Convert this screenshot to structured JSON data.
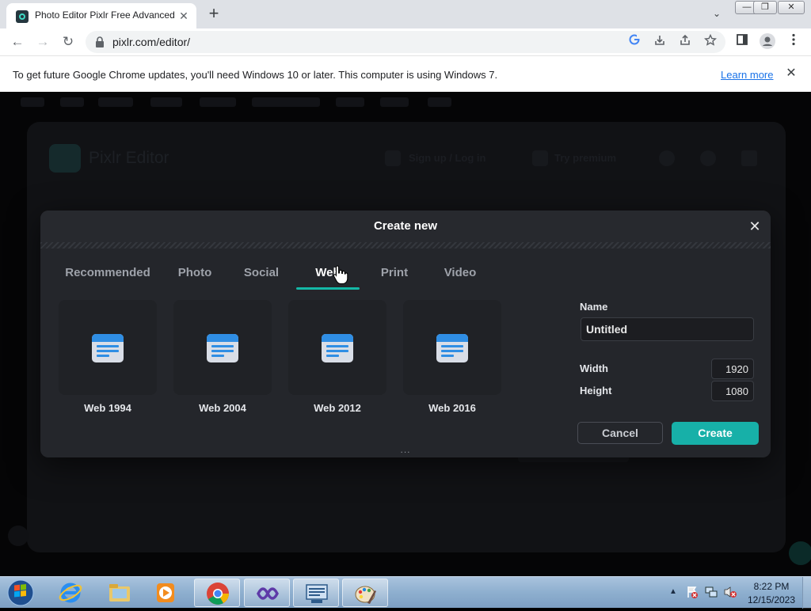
{
  "browser": {
    "tab_title": "Photo Editor Pixlr Free Advanced Photo Editor",
    "tab_close": "✕",
    "new_tab": "+",
    "tab_search": "⌄",
    "win_min": "—",
    "win_restore": "❐",
    "win_close": "✕",
    "back": "←",
    "forward": "→",
    "reload": "↻",
    "url": "pixlr.com/editor/",
    "lock": "🔒",
    "icons": [
      "google-icon",
      "download-icon",
      "share-icon",
      "star-icon",
      "sidebar-icon",
      "profile-icon",
      "kebab-menu-icon"
    ]
  },
  "infobar": {
    "message": "To get future Google Chrome updates, you'll need Windows 10 or later. This computer is using Windows 7.",
    "learn_more": "Learn more",
    "close": "✕"
  },
  "pixlr": {
    "brand": "Pixlr Editor",
    "signup": "Sign up / Log in",
    "premium": "Try premium"
  },
  "dialog": {
    "title": "Create new",
    "close": "✕",
    "tabs": [
      "Recommended",
      "Photo",
      "Social",
      "Web",
      "Print",
      "Video"
    ],
    "active_tab": "Web",
    "templates": [
      "Web 1994",
      "Web 2004",
      "Web 2012",
      "Web 2016"
    ],
    "name_label": "Name",
    "name_value": "Untitled",
    "width_label": "Width",
    "width_value": "1920",
    "height_label": "Height",
    "height_value": "1080",
    "cancel": "Cancel",
    "create": "Create",
    "handle": "...",
    "accent_color": "#17b0a8"
  },
  "taskbar": {
    "apps": [
      "start-orb",
      "internet-explorer",
      "file-explorer",
      "media-player",
      "google-chrome",
      "visual-studio",
      "keyboard-app",
      "paint"
    ],
    "time": "8:22 PM",
    "date": "12/15/2023",
    "tray_arrow": "▲"
  }
}
